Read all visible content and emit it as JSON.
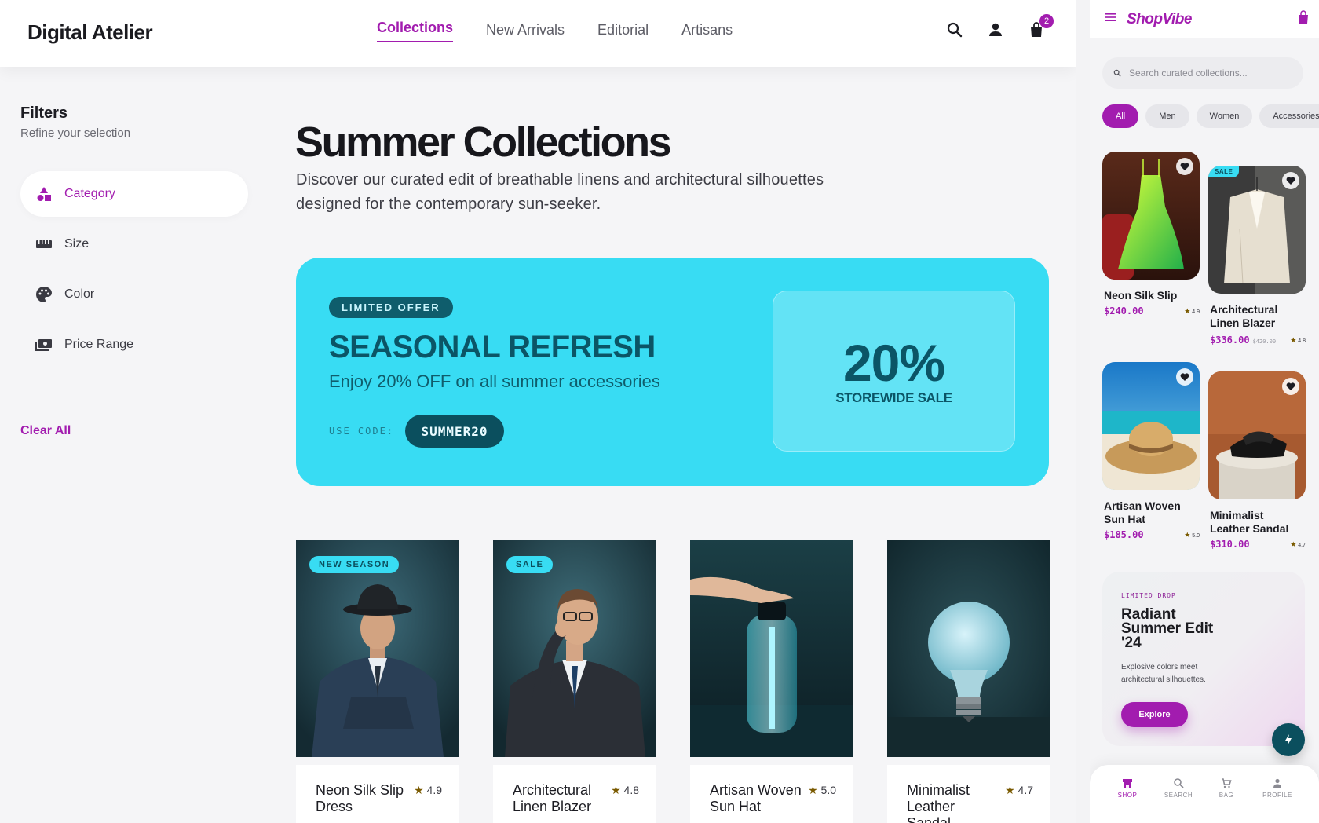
{
  "site": {
    "logo": "Digital Atelier",
    "nav": [
      "Collections",
      "New Arrivals",
      "Editorial",
      "Artisans"
    ],
    "cart_count": "2",
    "icons": [
      "search-icon",
      "account-icon",
      "shopping-bag-icon"
    ]
  },
  "sidebar": {
    "title": "Filters",
    "subtitle": "Refine your selection",
    "items": [
      {
        "label": "Category",
        "icon": "category-icon"
      },
      {
        "label": "Size",
        "icon": "ruler-icon"
      },
      {
        "label": "Color",
        "icon": "palette-icon"
      },
      {
        "label": "Price Range",
        "icon": "payments-icon"
      }
    ],
    "clear": "Clear All"
  },
  "main": {
    "title": "Summer Collections",
    "description": "Discover our curated edit of breathable linens and architectural silhouettes designed for the contemporary sun-seeker."
  },
  "promo": {
    "pill": "LIMITED OFFER",
    "title": "SEASONAL REFRESH",
    "subtitle": "Enjoy 20% OFF on all summer accessories",
    "code_label": "USE CODE:",
    "code": "SUMMER20",
    "percent": "20%",
    "box_label": "STOREWIDE SALE"
  },
  "products": [
    {
      "name": "Neon Silk Slip Dress",
      "rating": "4.9",
      "badge": "NEW SEASON"
    },
    {
      "name": "Architectural Linen Blazer",
      "rating": "4.8",
      "badge": "SALE"
    },
    {
      "name": "Artisan Woven Sun Hat",
      "rating": "5.0",
      "badge": ""
    },
    {
      "name": "Minimalist Leather Sandal",
      "rating": "4.7",
      "badge": ""
    }
  ],
  "mobile": {
    "logo": "ShopVibe",
    "search_placeholder": "Search curated collections...",
    "chips": [
      "All",
      "Men",
      "Women",
      "Accessories"
    ],
    "products": [
      {
        "name": "Neon Silk Slip",
        "price": "$240.00",
        "old_price": "",
        "rating": "4.9",
        "badge": ""
      },
      {
        "name": "Architectural Linen Blazer",
        "price": "$336.00",
        "old_price": "$420.00",
        "rating": "4.8",
        "badge": "SALE"
      },
      {
        "name": "Artisan Woven Sun Hat",
        "price": "$185.00",
        "old_price": "",
        "rating": "5.0",
        "badge": ""
      },
      {
        "name": "Minimalist Leather Sandal",
        "price": "$310.00",
        "old_price": "",
        "rating": "4.7",
        "badge": ""
      }
    ],
    "drop": {
      "tag": "LIMITED DROP",
      "title": "Radiant Summer Edit '24",
      "desc": "Explosive colors meet architectural silhouettes.",
      "button": "Explore"
    },
    "tabs": [
      "SHOP",
      "SEARCH",
      "BAG",
      "PROFILE"
    ]
  },
  "colors": {
    "accent": "#a21caf",
    "cyan": "#38dcf3",
    "teal": "#0b4f5e"
  }
}
